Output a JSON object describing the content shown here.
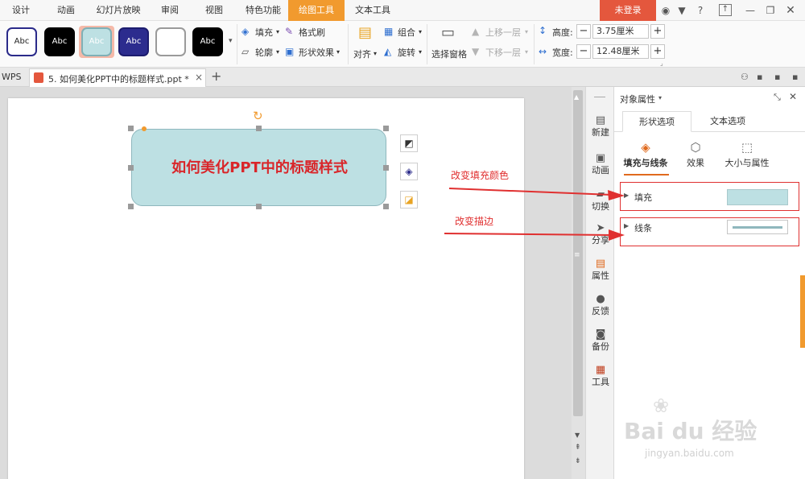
{
  "menubar": {
    "items": [
      {
        "label": "设计",
        "active": false
      },
      {
        "label": "动画",
        "active": false
      },
      {
        "label": "幻灯片放映",
        "active": false
      },
      {
        "label": "审阅",
        "active": false
      },
      {
        "label": "视图",
        "active": false
      },
      {
        "label": "特色功能",
        "active": false
      },
      {
        "label": "绘图工具",
        "active": true
      },
      {
        "label": "文本工具",
        "active": false
      }
    ],
    "login_label": "未登录",
    "help_label": "?"
  },
  "ribbon": {
    "style_swatch_label": "Abc",
    "fill_label": "填充",
    "format_painter_label": "格式刷",
    "outline_label": "轮廓",
    "shape_effect_label": "形状效果",
    "align_label": "对齐",
    "group_label": "组合",
    "rotate_label": "旋转",
    "selection_pane_label": "选择窗格",
    "bring_forward_label": "上移一层",
    "send_backward_label": "下移一层",
    "height_label": "高度:",
    "height_value": "3.75厘米",
    "width_label": "宽度:",
    "width_value": "12.48厘米",
    "minus": "−",
    "plus": "+"
  },
  "tabs": {
    "app_label": "WPS",
    "document_title": "5. 如何美化PPT中的标题样式.ppt *",
    "close_glyph": "×",
    "new_tab_glyph": "+"
  },
  "slide": {
    "shape_text": "如何美化PPT中的标题样式"
  },
  "side_toolbar": {
    "items": [
      {
        "label": "新建",
        "icon": "new-file-icon"
      },
      {
        "label": "动画",
        "icon": "animation-icon"
      },
      {
        "label": "切换",
        "icon": "transition-icon"
      },
      {
        "label": "分享",
        "icon": "share-icon"
      },
      {
        "label": "属性",
        "icon": "properties-icon"
      },
      {
        "label": "反馈",
        "icon": "feedback-icon"
      },
      {
        "label": "备份",
        "icon": "backup-icon"
      },
      {
        "label": "工具",
        "icon": "toolbox-icon"
      }
    ]
  },
  "panel": {
    "title": "对象属性",
    "tab_shape": "形状选项",
    "tab_text": "文本选项",
    "sub_fill_line": "填充与线条",
    "sub_effect": "效果",
    "sub_size": "大小与属性",
    "fill_label": "填充",
    "line_label": "线条"
  },
  "annotations": {
    "fill": "改变填充颜色",
    "stroke": "改变描边"
  },
  "watermark": {
    "logo": "Bai du 经验",
    "url": "jingyan.baidu.com"
  },
  "colors": {
    "active_tab": "#f19a2e",
    "login": "#e4573d",
    "shape_fill": "#bde0e3",
    "shape_text": "#d9262a",
    "annotation": "#e03030",
    "panel_accent": "#e06a1e"
  }
}
